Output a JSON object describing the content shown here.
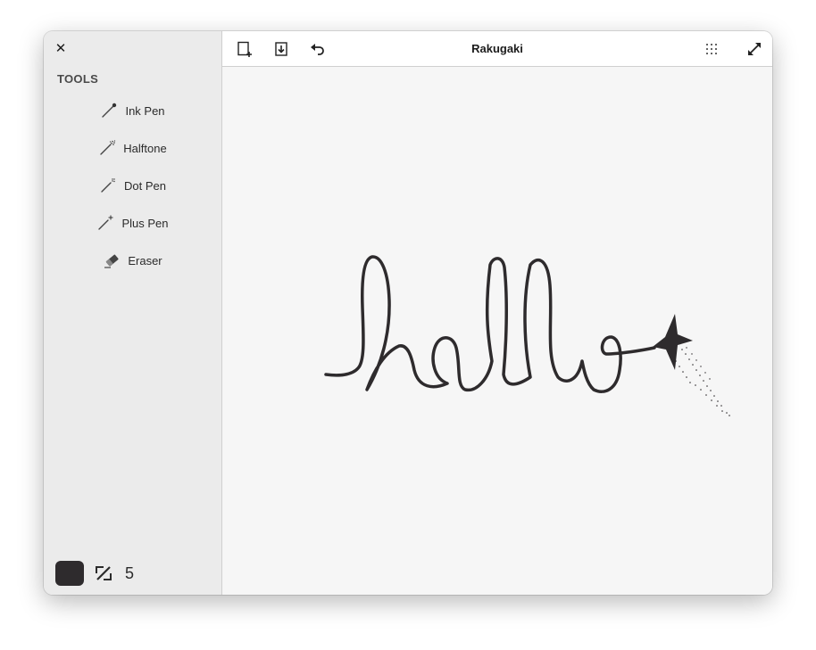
{
  "window": {
    "title": "Rakugaki"
  },
  "sidebar": {
    "heading": "TOOLS",
    "tools": [
      {
        "label": "Ink Pen",
        "icon": "ink-pen-icon"
      },
      {
        "label": "Halftone",
        "icon": "halftone-icon"
      },
      {
        "label": "Dot Pen",
        "icon": "dot-pen-icon"
      },
      {
        "label": "Plus Pen",
        "icon": "plus-pen-icon"
      },
      {
        "label": "Eraser",
        "icon": "eraser-icon"
      }
    ],
    "brush_color": "#2e2b2d",
    "brush_size": "5"
  },
  "header": {
    "buttons": [
      "new-canvas-icon",
      "save-icon",
      "undo-icon",
      "grid-icon",
      "fullscreen-icon"
    ]
  },
  "colors": {
    "sidebar_bg": "#ebebeb",
    "canvas_bg": "#f6f6f6",
    "ink": "#2e2b2d"
  }
}
